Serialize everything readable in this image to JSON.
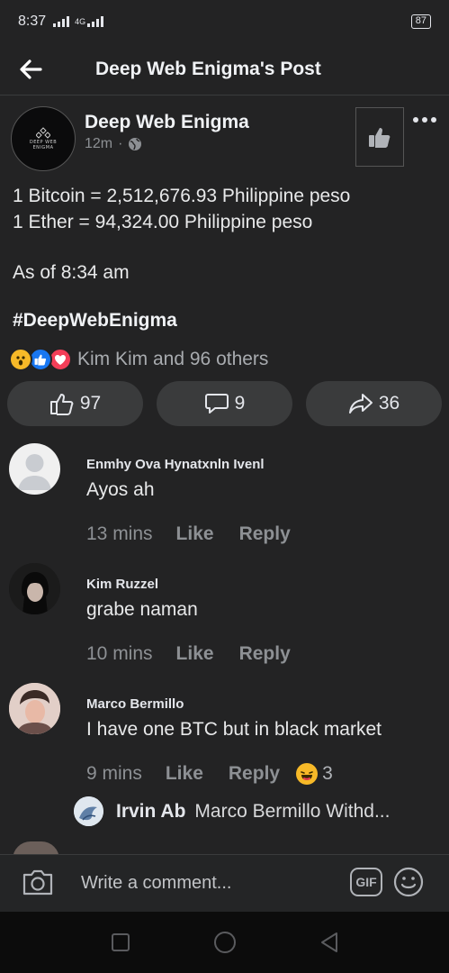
{
  "status_bar": {
    "time": "8:37",
    "network": "4G",
    "battery": "87"
  },
  "header": {
    "title": "Deep Web Enigma's Post"
  },
  "post": {
    "page_name": "Deep Web Enigma",
    "avatar_text": "DEEP WEB ENIGMA",
    "time": "12m",
    "lines": [
      "1 Bitcoin = 2,512,676.93 Philippine peso",
      "1 Ether = 94,324.00 Philippine peso"
    ],
    "as_of": "As of 8:34 am",
    "hashtag": "#DeepWebEnigma",
    "reactions_text": "Kim Kim and 96 others",
    "reaction_icons": [
      "wow-icon",
      "like-icon",
      "love-icon"
    ],
    "like_count": "97",
    "comment_count": "9",
    "share_count": "36"
  },
  "comments": [
    {
      "name": "Enmhy Ova Hynatxnln Ivenl",
      "text": "Ayos ah",
      "time": "13 mins",
      "like_label": "Like",
      "reply_label": "Reply"
    },
    {
      "name": "Kim Ruzzel",
      "text": "grabe naman",
      "time": "10 mins",
      "like_label": "Like",
      "reply_label": "Reply"
    },
    {
      "name": "Marco Bermillo",
      "text": "I have one BTC but in black market",
      "time": "9 mins",
      "like_label": "Like",
      "reply_label": "Reply",
      "reaction_count": "3"
    }
  ],
  "reply_preview": {
    "name": "Irvin Ab",
    "text": "Marco Bermillo Withd..."
  },
  "composer": {
    "placeholder": "Write a comment...",
    "gif_label": "GIF"
  },
  "colors": {
    "background": "#232324",
    "pill": "#3a3b3c",
    "like_blue": "#1877f2",
    "love_red": "#f33e58",
    "wow_yellow": "#f7b928"
  }
}
